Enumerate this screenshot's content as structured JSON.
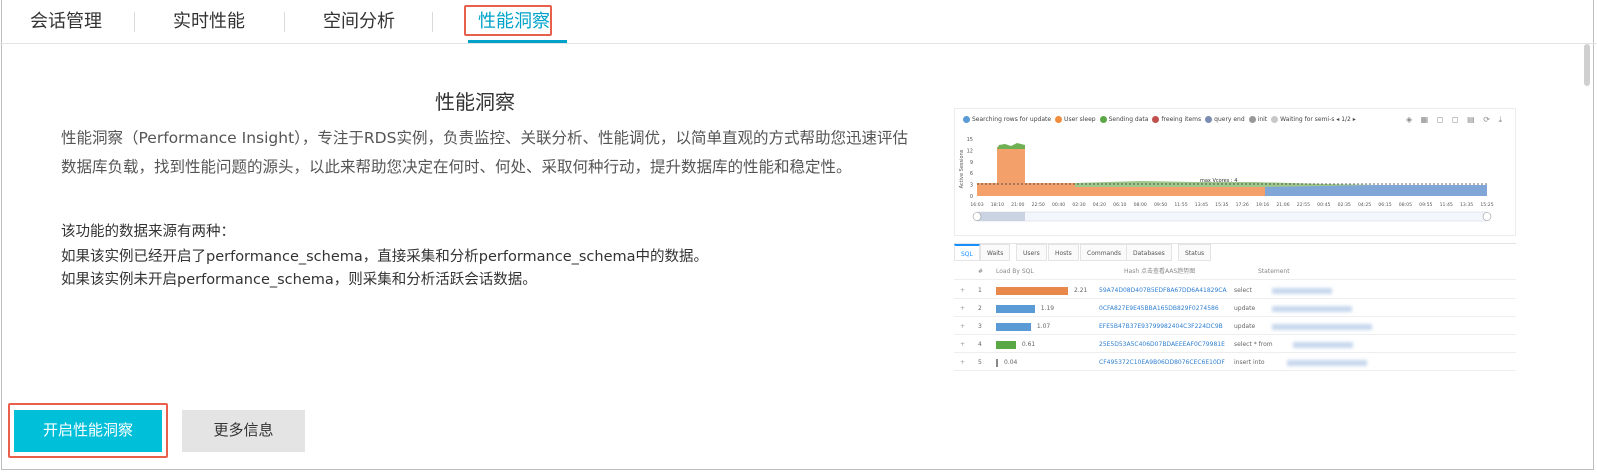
{
  "tabs": [
    {
      "label": "会话管理"
    },
    {
      "label": "实时性能"
    },
    {
      "label": "空间分析"
    },
    {
      "label": "性能洞察"
    }
  ],
  "active_tab": 3,
  "accent_color": "#00a2ca",
  "highlight_color": "#e8604c",
  "main": {
    "title": "性能洞察",
    "description": "性能洞察（Performance Insight），专注于RDS实例，负责监控、关联分析、性能调优，以简单直观的方式帮助您迅速评估数据库负载，找到性能问题的源头，以此来帮助您决定在何时、何处、采取何种行动，提升数据库的性能和稳定性。",
    "sources_title": "该功能的数据来源有两种：",
    "source_1": "如果该实例已经开启了performance_schema，直接采集和分析performance_schema中的数据。",
    "source_2": "如果该实例未开启performance_schema，则采集和分析活跃会话数据。"
  },
  "buttons": {
    "enable_label": "开启性能洞察",
    "more_label": "更多信息"
  },
  "preview": {
    "legend": [
      {
        "label": "Searching rows for update",
        "color": "#5b9bd5"
      },
      {
        "label": "User sleep",
        "color": "#f08c3c"
      },
      {
        "label": "Sending data",
        "color": "#5aa845"
      },
      {
        "label": "freeing items",
        "color": "#c0504d"
      },
      {
        "label": "query end",
        "color": "#7a8cb0"
      },
      {
        "label": "init",
        "color": "#999999"
      },
      {
        "label": "Waiting for semi-s",
        "color": "#c8c8c8"
      }
    ],
    "legend_page": "◂ 1/2 ▸",
    "ylabel": "Active Sessions",
    "yticks": [
      "15",
      "12",
      "9",
      "6",
      "3",
      "0"
    ],
    "xticks": [
      "16:03",
      "18:10",
      "21:00",
      "22:50",
      "00:40",
      "02:30",
      "04:20",
      "06:10",
      "08:00",
      "09:50",
      "11:55",
      "13:45",
      "15:35",
      "17:26",
      "19:16",
      "21:06",
      "22:55",
      "00:45",
      "02:35",
      "04:25",
      "06:15",
      "08:05",
      "09:55",
      "11:45",
      "13:35",
      "15:25"
    ],
    "max_label": "max Vcores : 4",
    "table_tabs": [
      "SQL",
      "Waits",
      "Users",
      "Hosts",
      "Commands",
      "Databases",
      "Status"
    ],
    "columns": [
      "#",
      "Load By SQL",
      "Hash 点击查看AAS趋势图",
      "Statement"
    ],
    "rows": [
      {
        "n": "1",
        "load": "2.21",
        "hash": "59A74D08D407B5EDF8A67DD6A41829CA",
        "stmt": "select"
      },
      {
        "n": "2",
        "load": "1.19",
        "hash": "0CFA827E9E45BBA165DB829F0274586",
        "stmt": "update"
      },
      {
        "n": "3",
        "load": "1.07",
        "hash": "EFE5B47B37E93799982404C3F224DC9B",
        "stmt": "update"
      },
      {
        "n": "4",
        "load": "0.61",
        "hash": "25E5D53A5C406D07BDAEEEAF0C79981E",
        "stmt": "select * from"
      },
      {
        "n": "5",
        "load": "0.04",
        "hash": "CF495372C10EA9B06DD8076CEC6E10DF",
        "stmt": "insert into"
      }
    ],
    "row_bar_colors": [
      "#e9884b",
      "#5b9bd5",
      "#5b9bd5",
      "#5aa845",
      "#888888"
    ]
  }
}
